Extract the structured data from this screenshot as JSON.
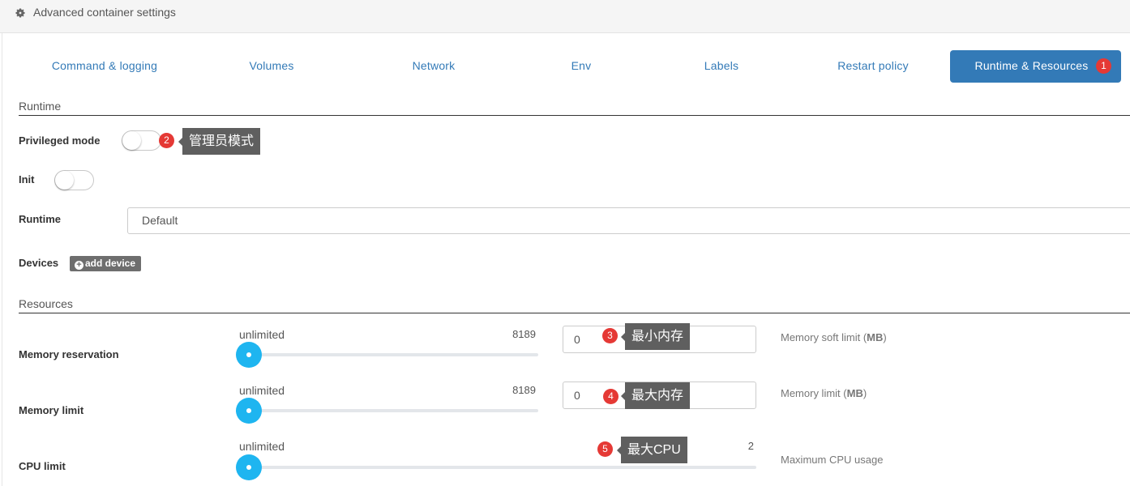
{
  "panel": {
    "title": "Advanced container settings",
    "icon": "gear-icon"
  },
  "tabs": [
    {
      "label": "Command & logging",
      "active": false
    },
    {
      "label": "Volumes",
      "active": false
    },
    {
      "label": "Network",
      "active": false
    },
    {
      "label": "Env",
      "active": false
    },
    {
      "label": "Labels",
      "active": false
    },
    {
      "label": "Restart policy",
      "active": false
    },
    {
      "label": "Runtime & Resources",
      "active": true
    }
  ],
  "runtime": {
    "section_title": "Runtime",
    "privileged_label": "Privileged mode",
    "privileged_on": false,
    "init_label": "Init",
    "init_on": false,
    "runtime_label": "Runtime",
    "runtime_value": "Default",
    "devices_label": "Devices",
    "add_device_label": "add device"
  },
  "resources": {
    "section_title": "Resources",
    "memory_reservation": {
      "label": "Memory reservation",
      "slider_min_label": "unlimited",
      "slider_max": "8189",
      "value": "0",
      "help_prefix": "Memory soft limit (",
      "help_unit": "MB",
      "help_suffix": ")"
    },
    "memory_limit": {
      "label": "Memory limit",
      "slider_min_label": "unlimited",
      "slider_max": "8189",
      "value": "0",
      "help_prefix": "Memory limit (",
      "help_unit": "MB",
      "help_suffix": ")"
    },
    "cpu_limit": {
      "label": "CPU limit",
      "slider_min_label": "unlimited",
      "slider_max": "2",
      "help": "Maximum CPU usage"
    }
  },
  "annotations": [
    {
      "number": "1"
    },
    {
      "number": "2",
      "text": "管理员模式"
    },
    {
      "number": "3",
      "text": "最小内存"
    },
    {
      "number": "4",
      "text": "最大内存"
    },
    {
      "number": "5",
      "text": "最大CPU"
    }
  ],
  "colors": {
    "accent": "#337ab7",
    "slider": "#1eb5f0",
    "badge": "#e53935",
    "callout": "#5f5f5f"
  }
}
